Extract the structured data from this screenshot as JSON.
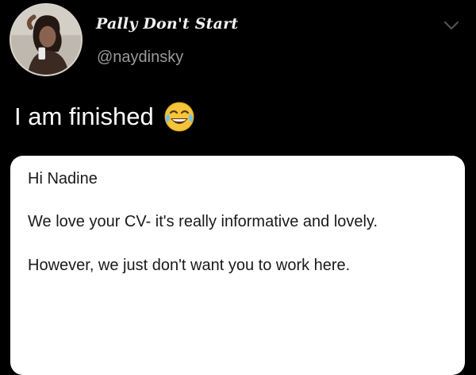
{
  "tweet": {
    "display_name": "Pally Don't Start",
    "handle": "@naydinsky",
    "text": "I am finished",
    "emoji": "face-with-tears-of-joy"
  },
  "screenshot": {
    "greeting": "Hi Nadine",
    "paragraph_1": "We love your CV- it's really informative and lovely.",
    "paragraph_2": "However, we just don't want you to work here."
  },
  "colors": {
    "background": "#000000",
    "handle": "#9a9a9a",
    "card": "#ffffff"
  }
}
